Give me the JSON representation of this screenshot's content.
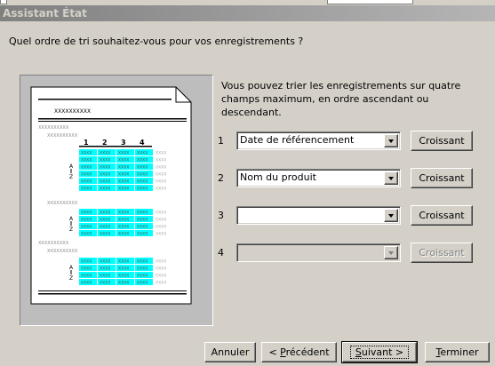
{
  "window": {
    "title": "Assistant État"
  },
  "question": "Quel ordre de tri souhaitez-vous pour vos enregistrements ?",
  "description": "Vous pouvez trier les enregistrements sur quatre champs maximum, en ordre ascendant ou descendant.",
  "preview": {
    "placeholder": "XXXXXXXXXX",
    "headers": [
      "1",
      "2",
      "3",
      "4"
    ],
    "cell": "XXXX",
    "sort_top": "A",
    "sort_bottom": "Z"
  },
  "sort_fields": [
    {
      "number": "1",
      "value": "Date de référencement",
      "order": "Croissant",
      "enabled": true
    },
    {
      "number": "2",
      "value": "Nom du produit",
      "order": "Croissant",
      "enabled": true
    },
    {
      "number": "3",
      "value": "",
      "order": "Croissant",
      "enabled": true
    },
    {
      "number": "4",
      "value": "",
      "order": "Croissant",
      "enabled": false
    }
  ],
  "buttons": {
    "cancel": "Annuler",
    "prev_prefix": "< ",
    "prev_key": "P",
    "prev_rest": "récédent",
    "next_key": "S",
    "next_rest": "uivant >",
    "finish_key": "T",
    "finish_rest": "erminer"
  },
  "colors": {
    "highlight": "#00ffff",
    "titlebar": "#808080"
  }
}
